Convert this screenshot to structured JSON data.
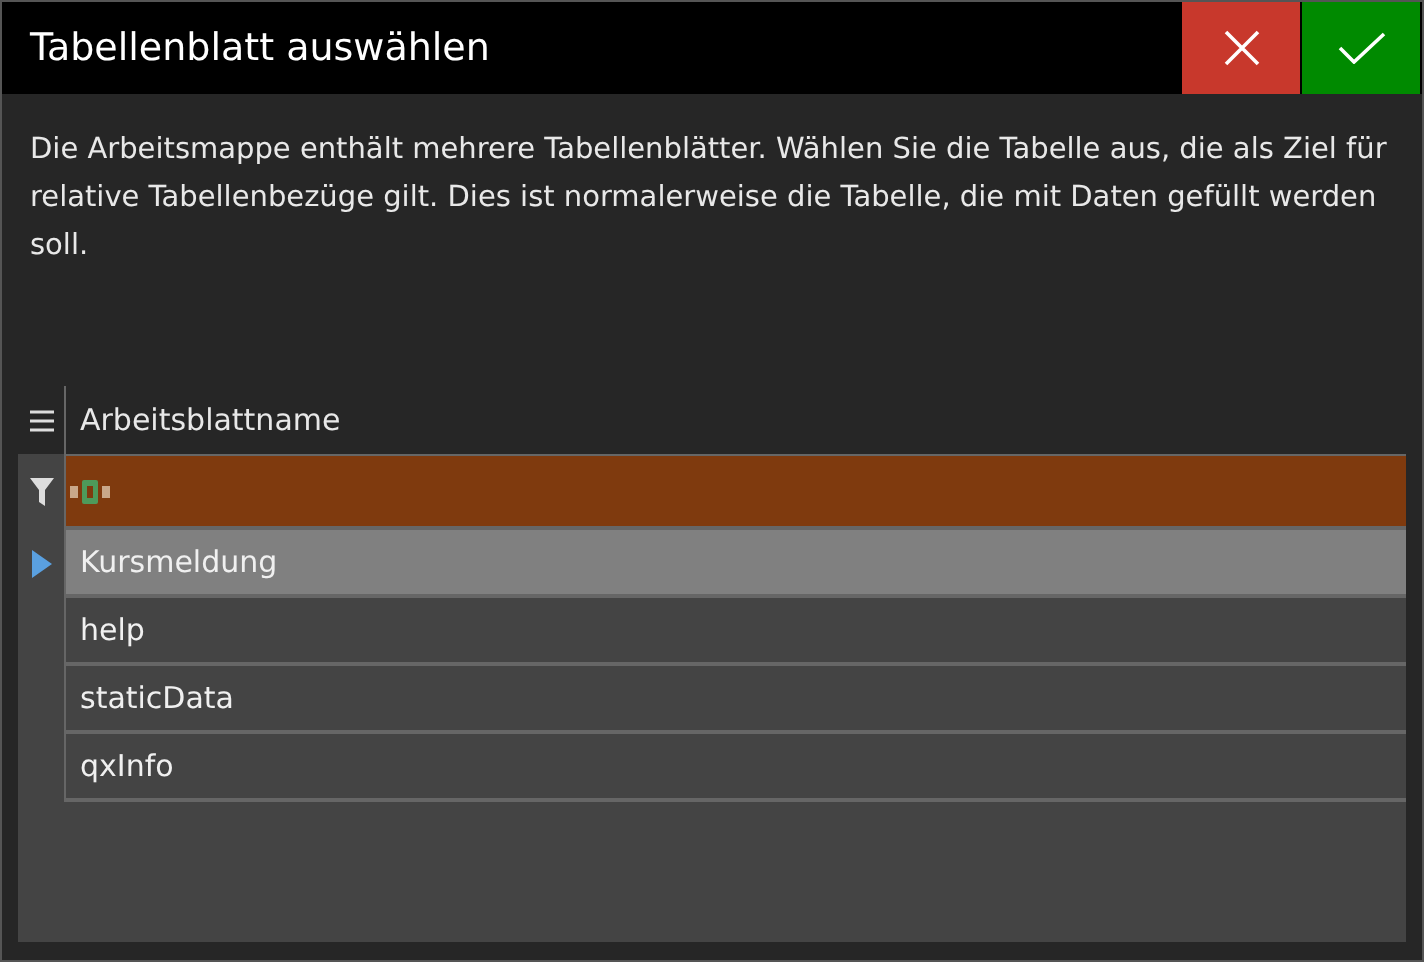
{
  "window": {
    "title": "Tabellenblatt auswählen"
  },
  "description": "Die Arbeitsmappe enthält mehrere Tabellenblätter. Wählen Sie die Tabelle aus, die als Ziel für relative Tabellenbezüge gilt. Dies ist normalerweise die Tabelle, die mit Daten gefüllt werden soll.",
  "table": {
    "columns": [
      "Arbeitsblattname"
    ],
    "rows": [
      {
        "name": "Kursmeldung",
        "selected": true
      },
      {
        "name": "help",
        "selected": false
      },
      {
        "name": "staticData",
        "selected": false
      },
      {
        "name": "qxInfo",
        "selected": false
      }
    ]
  }
}
